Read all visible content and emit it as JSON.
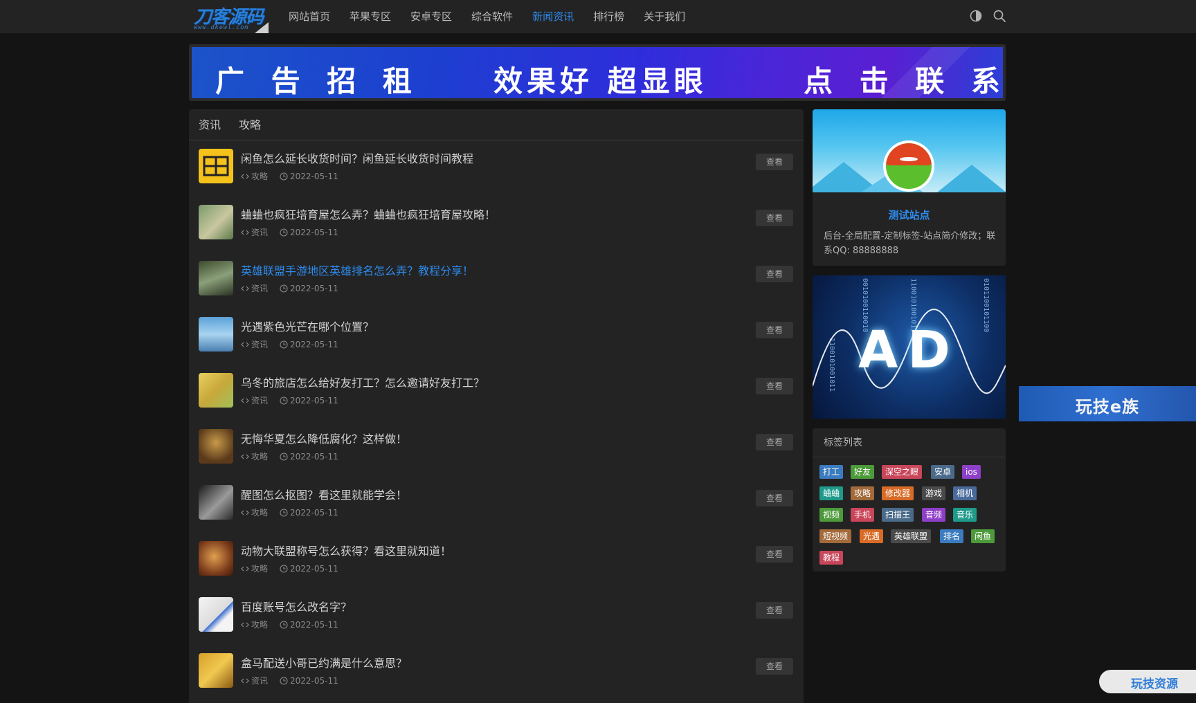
{
  "header": {
    "logo_main": "刀客源码",
    "logo_sub": "www.dkewl.com",
    "nav": [
      {
        "label": "网站首页",
        "active": false
      },
      {
        "label": "苹果专区",
        "active": false
      },
      {
        "label": "安卓专区",
        "active": false
      },
      {
        "label": "综合软件",
        "active": false
      },
      {
        "label": "新闻资讯",
        "active": true
      },
      {
        "label": "排行榜",
        "active": false
      },
      {
        "label": "关于我们",
        "active": false
      }
    ],
    "icons": [
      "theme-toggle-icon",
      "search-icon"
    ]
  },
  "banner": {
    "left": "广 告 招 租",
    "middle": "效果好 超显眼",
    "right": "点 击 联 系"
  },
  "tabs": [
    "资讯",
    "攻略"
  ],
  "view_label": "查看",
  "articles": [
    {
      "title": "闲鱼怎么延长收货时间？闲鱼延长收货时间教程",
      "category": "攻略",
      "date": "2022-05-11",
      "highlight": false
    },
    {
      "title": "蛐蛐也疯狂培育屋怎么弄？蛐蛐也疯狂培育屋攻略！",
      "category": "资讯",
      "date": "2022-05-11",
      "highlight": false
    },
    {
      "title": "英雄联盟手游地区英雄排名怎么弄？教程分享！",
      "category": "资讯",
      "date": "2022-05-11",
      "highlight": true
    },
    {
      "title": "光遇紫色光芒在哪个位置？",
      "category": "资讯",
      "date": "2022-05-11",
      "highlight": false
    },
    {
      "title": "乌冬的旅店怎么给好友打工？怎么邀请好友打工？",
      "category": "资讯",
      "date": "2022-05-11",
      "highlight": false
    },
    {
      "title": "无悔华夏怎么降低腐化？这样做！",
      "category": "攻略",
      "date": "2022-05-11",
      "highlight": false
    },
    {
      "title": "醒图怎么抠图？看这里就能学会！",
      "category": "攻略",
      "date": "2022-05-11",
      "highlight": false
    },
    {
      "title": "动物大联盟称号怎么获得？看这里就知道！",
      "category": "攻略",
      "date": "2022-05-11",
      "highlight": false
    },
    {
      "title": "百度账号怎么改名字？",
      "category": "攻略",
      "date": "2022-05-11",
      "highlight": false
    },
    {
      "title": "盒马配送小哥已约满是什么意思？",
      "category": "资讯",
      "date": "2022-05-11",
      "highlight": false
    }
  ],
  "profile": {
    "name": "测试站点",
    "description": "后台-全局配置-定制标签-站点简介修改；联系QQ: 88888888"
  },
  "sidebar_ad": {
    "text": "AD"
  },
  "tags": {
    "title": "标签列表",
    "items": [
      {
        "label": "打工",
        "color": "#3b7bbf"
      },
      {
        "label": "好友",
        "color": "#4d9a3a"
      },
      {
        "label": "深空之眼",
        "color": "#c9465a"
      },
      {
        "label": "安卓",
        "color": "#4a6a8a"
      },
      {
        "label": "ios",
        "color": "#8e3fc7"
      },
      {
        "label": "蛐蛐",
        "color": "#1f9a8a"
      },
      {
        "label": "攻略",
        "color": "#a36a3a"
      },
      {
        "label": "修改器",
        "color": "#d86b26"
      },
      {
        "label": "游戏",
        "color": "#4a4a4a"
      },
      {
        "label": "相机",
        "color": "#4a6a9a"
      },
      {
        "label": "视频",
        "color": "#4d9a3a"
      },
      {
        "label": "手机",
        "color": "#c9465a"
      },
      {
        "label": "扫描王",
        "color": "#4a6a8a"
      },
      {
        "label": "音频",
        "color": "#8e3fc7"
      },
      {
        "label": "音乐",
        "color": "#1f9a8a"
      },
      {
        "label": "短视频",
        "color": "#a36a3a"
      },
      {
        "label": "光遇",
        "color": "#d86b26"
      },
      {
        "label": "英雄联盟",
        "color": "#4a4a4a"
      },
      {
        "label": "排名",
        "color": "#3b7bbf"
      },
      {
        "label": "闲鱼",
        "color": "#4d9a3a"
      },
      {
        "label": "教程",
        "color": "#c9465a"
      }
    ]
  },
  "float_ad": {
    "text": "玩技e族"
  },
  "float_corner": {
    "text": "玩技资源"
  }
}
